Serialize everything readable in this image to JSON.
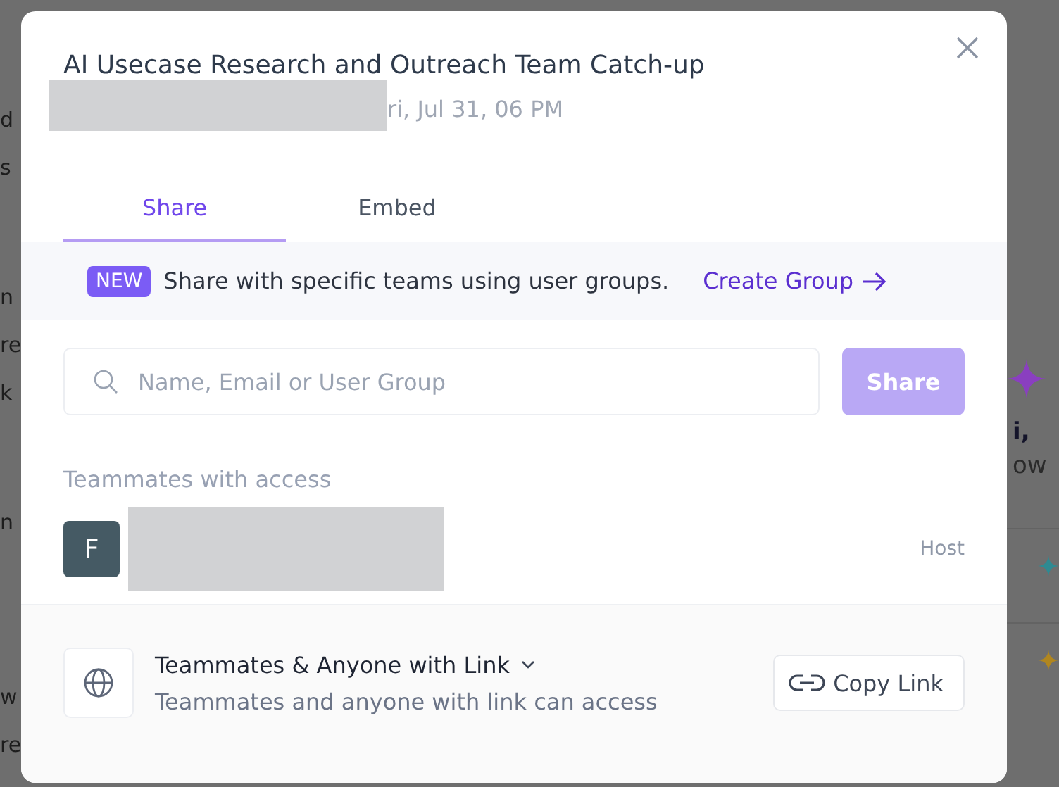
{
  "background": {
    "left_fragments": [
      "d",
      "s",
      "n",
      "re",
      "k",
      "n",
      "w",
      "re"
    ],
    "greeting": "i,",
    "subgreeting": "ow"
  },
  "dialog": {
    "title": "AI Usecase Research and Outreach Team Catch-up",
    "subtitle": "ri, Jul 31, 06 PM"
  },
  "tabs": [
    {
      "label": "Share",
      "selected": true
    },
    {
      "label": "Embed",
      "selected": false
    }
  ],
  "banner": {
    "badge": "NEW",
    "text": "Share with specific teams using user groups.",
    "link": "Create Group"
  },
  "search": {
    "placeholder": "Name, Email or User Group"
  },
  "share_button": {
    "label": "Share",
    "disabled": true
  },
  "access": {
    "heading": "Teammates with access",
    "members": [
      {
        "initial": "F",
        "role": "Host"
      }
    ]
  },
  "link_settings": {
    "title": "Teammates & Anyone with Link",
    "description": "Teammates and anyone with link can access"
  },
  "copy_button": {
    "label": "Copy Link"
  }
}
